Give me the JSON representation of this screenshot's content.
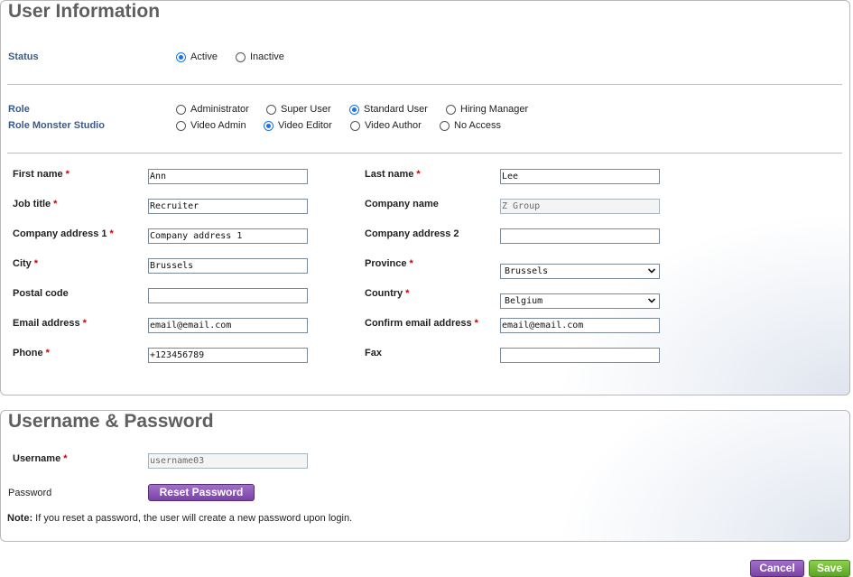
{
  "user_info": {
    "title": "User Information",
    "status": {
      "label": "Status",
      "options": [
        {
          "label": "Active",
          "checked": true
        },
        {
          "label": "Inactive",
          "checked": false
        }
      ]
    },
    "role": {
      "label": "Role",
      "options": [
        {
          "label": "Administrator",
          "checked": false
        },
        {
          "label": "Super User",
          "checked": false
        },
        {
          "label": "Standard User",
          "checked": true
        },
        {
          "label": "Hiring Manager",
          "checked": false
        }
      ]
    },
    "role_monster_studio": {
      "label": "Role Monster Studio",
      "options": [
        {
          "label": "Video Admin",
          "checked": false
        },
        {
          "label": "Video Editor",
          "checked": true
        },
        {
          "label": "Video Author",
          "checked": false
        },
        {
          "label": "No Access",
          "checked": false
        }
      ]
    },
    "fields": {
      "first_name": {
        "label": "First name",
        "required": "*",
        "value": "Ann"
      },
      "last_name": {
        "label": "Last name",
        "required": "*",
        "value": "Lee"
      },
      "job_title": {
        "label": "Job title",
        "required": "*",
        "value": "Recruiter"
      },
      "company_name": {
        "label": "Company name",
        "value": "Z Group"
      },
      "company_address_1": {
        "label": "Company address 1",
        "required": "*",
        "value": "Company address 1"
      },
      "company_address_2": {
        "label": "Company address 2",
        "value": ""
      },
      "city": {
        "label": "City",
        "required": "*",
        "value": "Brussels"
      },
      "province": {
        "label": "Province",
        "required": "*",
        "value": "Brussels"
      },
      "postal_code": {
        "label": "Postal code",
        "value": ""
      },
      "country": {
        "label": "Country",
        "required": "*",
        "value": "Belgium"
      },
      "email": {
        "label": "Email address",
        "required": "*",
        "value": "email@email.com"
      },
      "confirm_email": {
        "label": "Confirm email address",
        "required": "*",
        "value": "email@email.com"
      },
      "phone": {
        "label": "Phone",
        "required": "*",
        "value": "+123456789"
      },
      "fax": {
        "label": "Fax",
        "value": ""
      }
    }
  },
  "credentials": {
    "title": "Username & Password",
    "username": {
      "label": "Username",
      "required": "*",
      "value": "username03"
    },
    "password": {
      "label": "Password",
      "button": "Reset Password"
    },
    "note_prefix": "Note:",
    "note_text": "If you reset a password, the user will create a new password upon login."
  },
  "actions": {
    "cancel": "Cancel",
    "save": "Save"
  },
  "colors": {
    "accent_blue": "#3b5a8c",
    "radio_selected": "#1a73e8",
    "required": "#cc0000",
    "cancel_button": "#7b42a8",
    "save_button": "#5aa526"
  }
}
